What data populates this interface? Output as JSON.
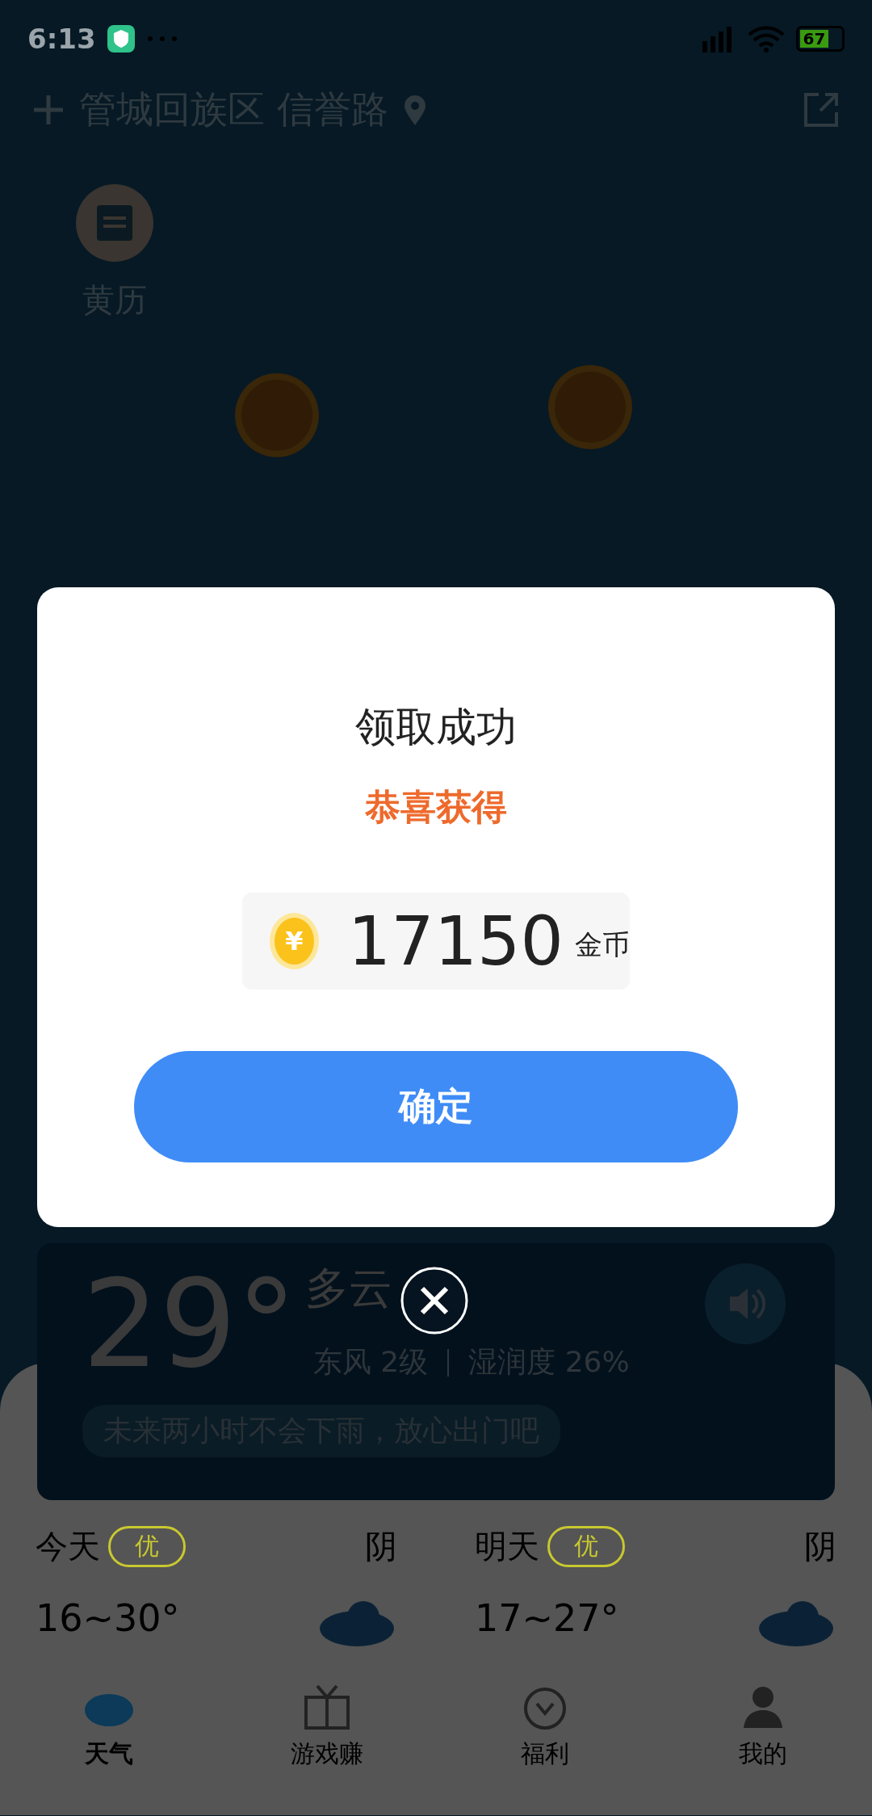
{
  "status_bar": {
    "time": "6:13",
    "battery": "67"
  },
  "header": {
    "location": "管城回族区 信誉路"
  },
  "shortcuts": [
    {
      "label": "黄历"
    }
  ],
  "dialog": {
    "title": "领取成功",
    "subtitle": "恭喜获得",
    "coin_symbol": "¥",
    "amount": "17150",
    "unit": "金币",
    "confirm": "确定"
  },
  "weather": {
    "temperature": "29°",
    "condition": "多云",
    "wind": "东风 2级",
    "humidity": "湿润度 26%",
    "note": "未来两小时不会下雨，放心出门吧"
  },
  "forecast": [
    {
      "day": "今天",
      "aqi": "优",
      "condition": "阴",
      "range": "16~30°"
    },
    {
      "day": "明天",
      "aqi": "优",
      "condition": "阴",
      "range": "17~27°"
    }
  ],
  "tabs": [
    {
      "label": "天气",
      "kind": "weather",
      "selected": true
    },
    {
      "label": "游戏赚",
      "kind": "gift",
      "selected": false
    },
    {
      "label": "福利",
      "kind": "bag",
      "selected": false
    },
    {
      "label": "我的",
      "kind": "person",
      "selected": false
    }
  ]
}
